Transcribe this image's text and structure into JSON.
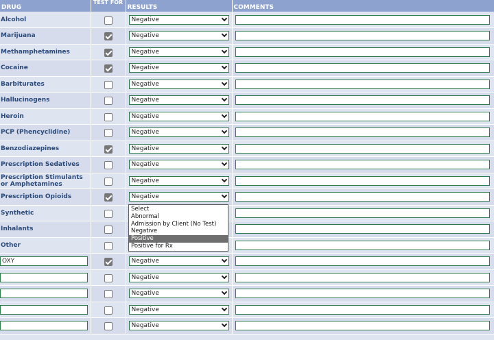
{
  "headers": {
    "drug": "DRUG",
    "test_for": "TEST FOR",
    "results": "RESULTS",
    "comments": "COMMENTS"
  },
  "rows": [
    {
      "drug": "Alcohol",
      "checked": false,
      "result": "Negative"
    },
    {
      "drug": "Marijuana",
      "checked": true,
      "result": "Negative"
    },
    {
      "drug": "Methamphetamines",
      "checked": true,
      "result": "Negative"
    },
    {
      "drug": "Cocaine",
      "checked": true,
      "result": "Negative"
    },
    {
      "drug": "Barbiturates",
      "checked": false,
      "result": "Negative"
    },
    {
      "drug": "Hallucinogens",
      "checked": false,
      "result": "Negative"
    },
    {
      "drug": "Heroin",
      "checked": false,
      "result": "Negative"
    },
    {
      "drug": "PCP (Phencyclidine)",
      "checked": false,
      "result": "Negative"
    },
    {
      "drug": "Benzodiazepines",
      "checked": true,
      "result": "Negative"
    },
    {
      "drug": "Prescription Sedatives",
      "checked": false,
      "result": "Negative"
    },
    {
      "drug": "Prescription Stimulants or Amphetamines",
      "checked": false,
      "result": "Negative"
    },
    {
      "drug": "Prescription Opioids",
      "checked": true,
      "result": "Negative"
    },
    {
      "drug": "Synthetic",
      "checked": false,
      "result": ""
    },
    {
      "drug": "Inhalants",
      "checked": false,
      "result": ""
    },
    {
      "drug": "Other",
      "checked": false,
      "result": ""
    },
    {
      "drug_input": "OXY",
      "checked": true,
      "result": "Negative"
    },
    {
      "drug_input": "",
      "checked": false,
      "result": "Negative"
    },
    {
      "drug_input": "",
      "checked": false,
      "result": "Negative"
    },
    {
      "drug_input": "",
      "checked": false,
      "result": "Negative"
    },
    {
      "drug_input": "",
      "checked": false,
      "result": "Negative"
    }
  ],
  "dropdown": {
    "options": [
      "Select",
      "Abnormal",
      "Admission by Client (No Test)",
      "Negative",
      "Positive",
      "Positive for Rx"
    ],
    "highlighted": "Positive"
  }
}
